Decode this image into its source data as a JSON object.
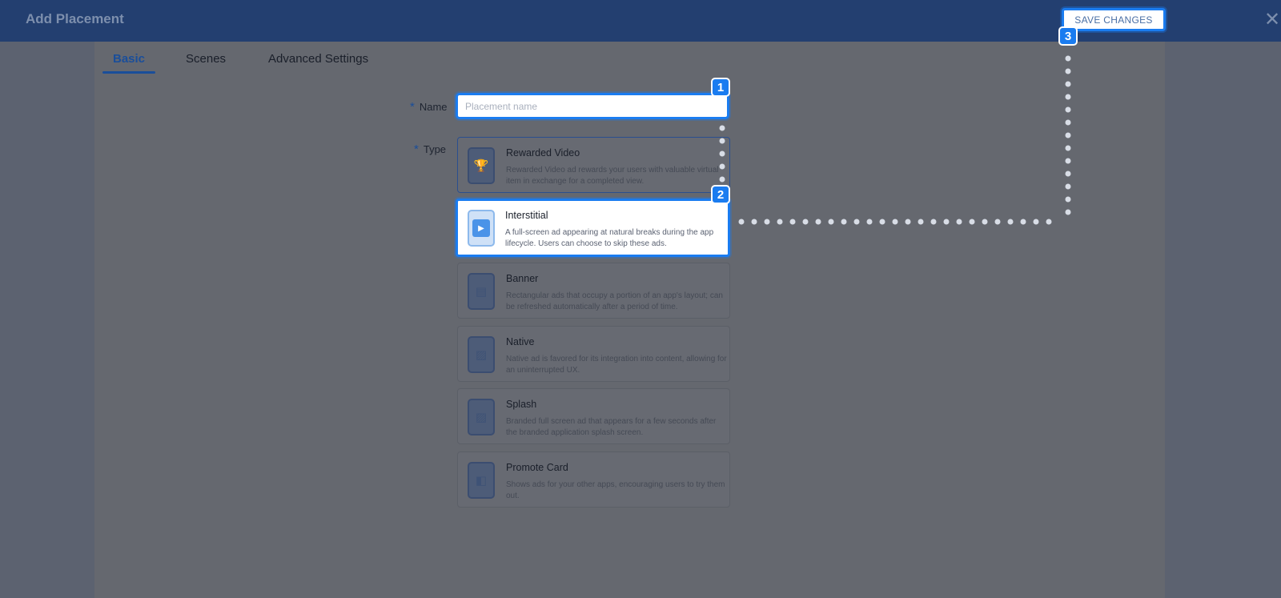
{
  "header": {
    "title": "Add Placement",
    "save_label": "SAVE CHANGES",
    "close_symbol": "✕"
  },
  "tabs": [
    {
      "label": "Basic",
      "active": true
    },
    {
      "label": "Scenes",
      "active": false
    },
    {
      "label": "Advanced Settings",
      "active": false
    }
  ],
  "form": {
    "name_label": "Name",
    "name_placeholder": "Placement name",
    "name_value": "",
    "type_label": "Type",
    "required_marker": "*"
  },
  "placement_types": [
    {
      "title": "Rewarded Video",
      "description": "Rewarded Video ad rewards your users with valuable virtual item in exchange for a completed view.",
      "icon": "trophy-icon",
      "selected": false
    },
    {
      "title": "Interstitial",
      "description": "A full-screen ad appearing at natural breaks during the app lifecycle. Users can choose to skip these ads.",
      "icon": "play-icon",
      "selected": true
    },
    {
      "title": "Banner",
      "description": "Rectangular ads that occupy a portion of an app's layout; can be refreshed automatically after a period of time.",
      "icon": "banner-icon",
      "selected": false
    },
    {
      "title": "Native",
      "description": "Native ad is favored for its integration into content, allowing for an uninterrupted UX.",
      "icon": "image-icon",
      "selected": false
    },
    {
      "title": "Splash",
      "description": "Branded full screen ad that appears for a few seconds after the branded application splash screen.",
      "icon": "image-icon",
      "selected": false
    },
    {
      "title": "Promote Card",
      "description": "Shows ads for your other apps, encouraging users to try them out.",
      "icon": "card-icon",
      "selected": false
    }
  ],
  "steps": [
    "1",
    "2",
    "3"
  ],
  "colors": {
    "header": "#233f70",
    "accent": "#1a7cf0",
    "active_tab": "#1a4e9a",
    "overlay": "#5c6270"
  }
}
